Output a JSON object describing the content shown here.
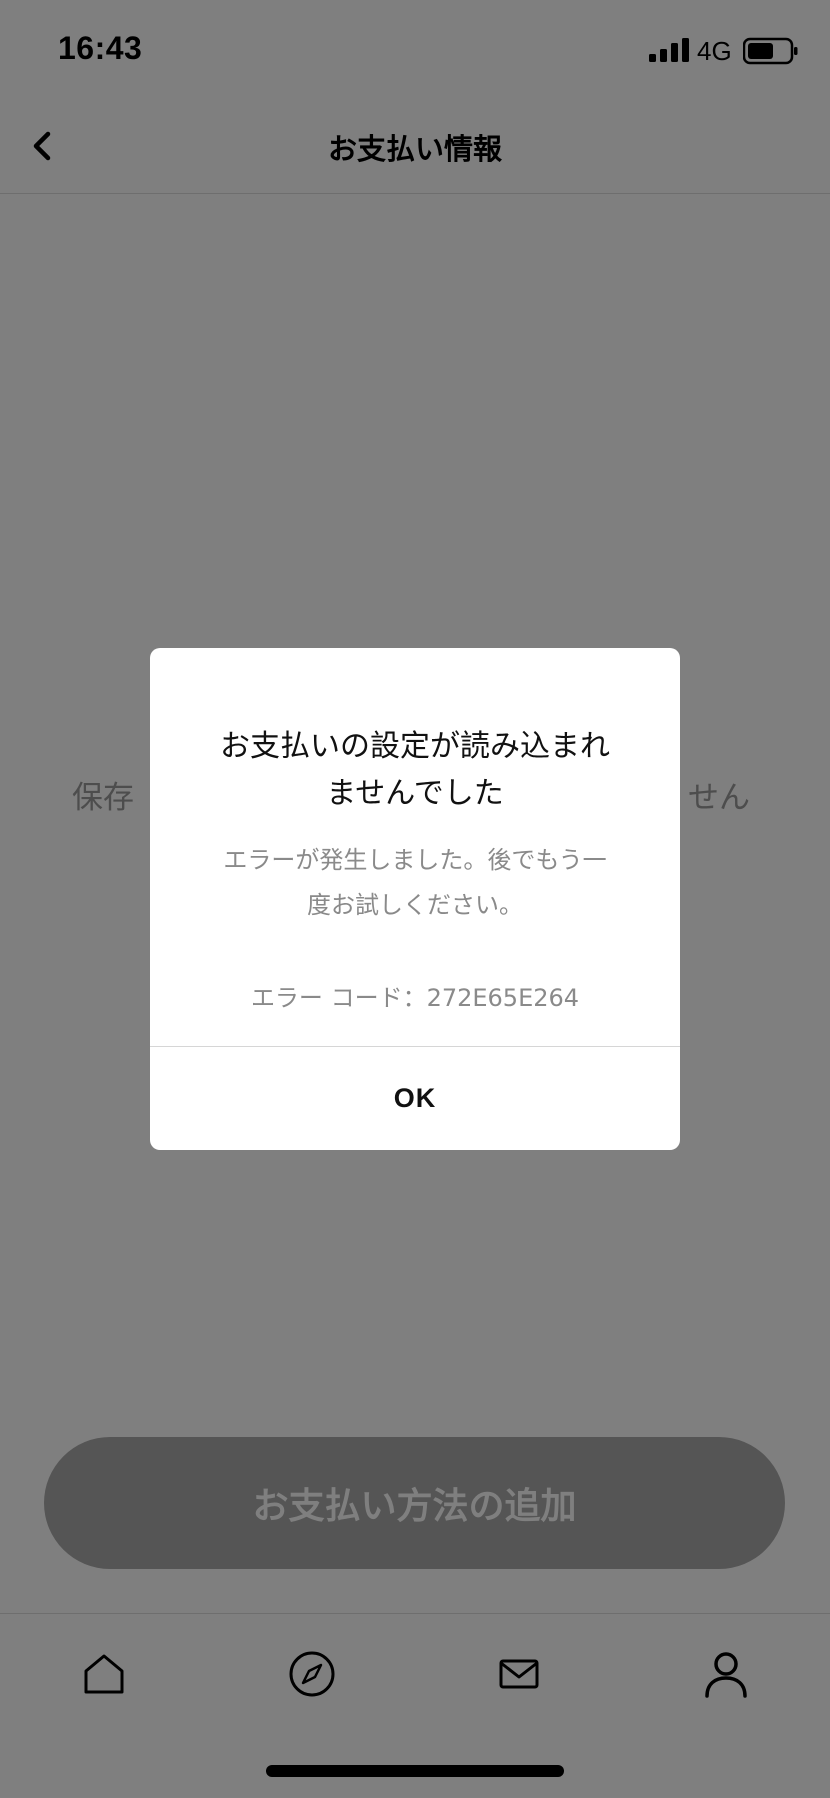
{
  "status_bar": {
    "time": "16:43",
    "network": "4G",
    "signal_icon": "cellular-signal-icon",
    "battery_icon": "battery-icon"
  },
  "nav": {
    "back_icon": "chevron-left-icon",
    "title": "お支払い情報"
  },
  "empty_state": {
    "text_left": "保存",
    "text_right": "せん"
  },
  "add_payment_button": {
    "label": "お支払い方法の追加"
  },
  "tab_bar": {
    "tabs": [
      {
        "icon": "home-icon",
        "active": false
      },
      {
        "icon": "compass-icon",
        "active": false
      },
      {
        "icon": "mail-icon",
        "active": false
      },
      {
        "icon": "profile-icon",
        "active": true
      }
    ]
  },
  "dialog": {
    "title_line1": "お支払いの設定が読み込まれ",
    "title_line2": "ませんでした",
    "message_line1": "エラーが発生しました。後でもう一",
    "message_line2": "度お試しください。",
    "error_code": "エラー コード：272E65E264",
    "ok_label": "OK"
  },
  "colors": {
    "overlay": "#000000",
    "dialog_background": "#ffffff",
    "muted_text": "#8a8a8a",
    "disabled_button": "#aaaaaa"
  }
}
